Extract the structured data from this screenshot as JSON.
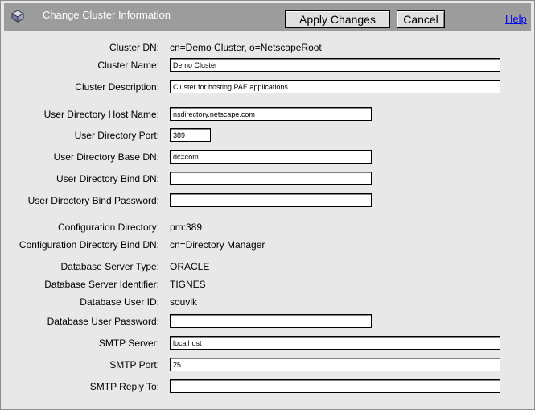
{
  "header": {
    "title": "Change Cluster Information",
    "apply_label": "Apply Changes",
    "cancel_label": "Cancel",
    "help_label": "Help"
  },
  "fields": {
    "cluster_dn": {
      "label": "Cluster DN:",
      "value": "cn=Demo Cluster, o=NetscapeRoot"
    },
    "cluster_name": {
      "label": "Cluster Name:",
      "value": "Demo Cluster"
    },
    "cluster_description": {
      "label": "Cluster Description:",
      "value": "Cluster for hosting PAE applications"
    },
    "ud_host": {
      "label": "User Directory Host Name:",
      "value": "nsdirectory.netscape.com"
    },
    "ud_port": {
      "label": "User Directory Port:",
      "value": "389"
    },
    "ud_base_dn": {
      "label": "User Directory Base DN:",
      "value": "dc=com"
    },
    "ud_bind_dn": {
      "label": "User Directory Bind DN:",
      "value": ""
    },
    "ud_bind_password": {
      "label": "User Directory Bind Password:",
      "value": ""
    },
    "config_dir": {
      "label": "Configuration Directory:",
      "value": "pm:389"
    },
    "config_dir_bind_dn": {
      "label": "Configuration Directory Bind DN:",
      "value": "cn=Directory Manager"
    },
    "db_server_type": {
      "label": "Database Server Type:",
      "value": "ORACLE"
    },
    "db_server_id": {
      "label": "Database Server Identifier:",
      "value": "TIGNES"
    },
    "db_user_id": {
      "label": "Database User ID:",
      "value": "souvik"
    },
    "db_user_password": {
      "label": "Database User Password:",
      "value": ""
    },
    "smtp_server": {
      "label": "SMTP Server:",
      "value": "localhost"
    },
    "smtp_port": {
      "label": "SMTP Port:",
      "value": "25"
    },
    "smtp_reply_to": {
      "label": "SMTP Reply To:",
      "value": ""
    }
  }
}
